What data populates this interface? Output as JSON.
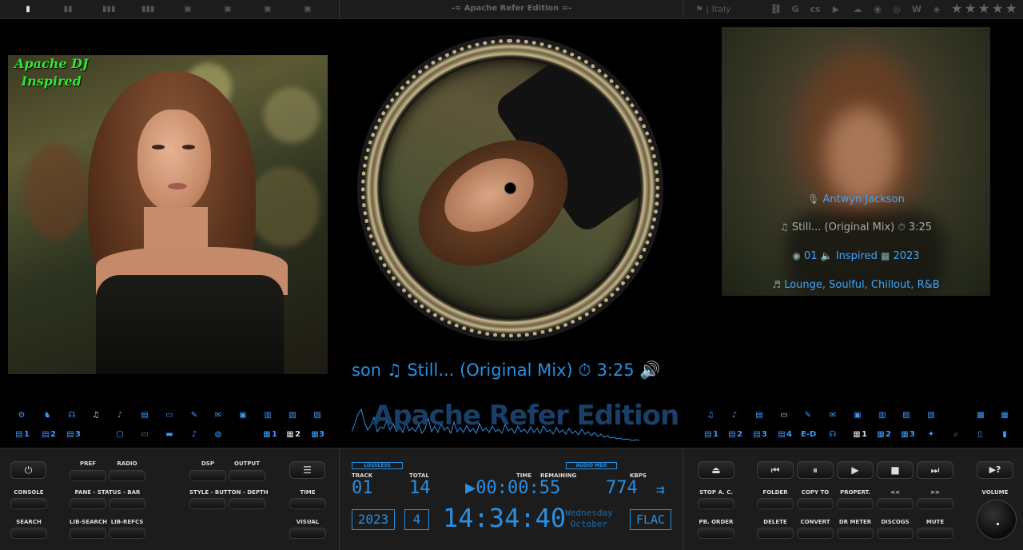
{
  "topbar": {
    "title": "-= Apache Refer Edition =-",
    "country": "Italy",
    "layout_icons": [
      "1",
      "2",
      "3",
      "4",
      "icon-a",
      "icon-b",
      "icon-c",
      "icon-d"
    ],
    "services": [
      "link-icon",
      "G",
      "cs",
      "youtube-icon",
      "soundcloud-icon",
      "spotify-icon",
      "discogs-icon",
      "W",
      "shazam-icon"
    ],
    "rating": 0
  },
  "left": {
    "badge_line1": "Apache DJ",
    "badge_line2": "Inspired"
  },
  "right_info": {
    "artist": "Antwyn Jackson",
    "title": "Still... (Original Mix)",
    "duration": "3:25",
    "track": "01",
    "album": "Inspired",
    "year": "2023",
    "genres": "Lounge, Soulful, Chillout, R&B"
  },
  "nowplaying": {
    "artist_tail": "son",
    "title": "Still... (Original Mix)",
    "duration": "3:25"
  },
  "wave_title": "Apache Refer Edition",
  "left_icons_row1": [
    "settings-icon",
    "dancer-icon",
    "headphones-icon",
    "music-icon",
    "guitar-icon",
    "document-icon",
    "screen-icon",
    "edit-icon",
    "mail-icon",
    "box-icon",
    "basket-icon",
    "image-icon",
    "gallery-icon"
  ],
  "left_icons_row2": {
    "a": "1",
    "b": "2",
    "c": "3",
    "d": "1",
    "e": "2",
    "f": "3"
  },
  "right_icons_row2": {
    "a": "1",
    "b": "2",
    "c": "3",
    "d": "4",
    "e": "E-D",
    "f": "1",
    "g": "2",
    "h": "3"
  },
  "bottom_left": {
    "pref": "PREF",
    "radio": "RADIO",
    "dsp": "DSP",
    "output": "OUTPUT",
    "console": "CONSOLE",
    "pane": "PANE - STATUS - BAR",
    "style": "STYLE - BUTTON - DEPTH",
    "time": "TIME",
    "search": "SEARCH",
    "lib_search": "LIB-SEARCH",
    "lib_refcs": "LIB-REFCS",
    "visual": "VISUAL"
  },
  "lcd": {
    "lossless": "LOSSLESS",
    "audio_mds": "AUDIO MDS",
    "track_lbl": "TRACK",
    "total_lbl": "TOTAL",
    "time_lbl": "TIME",
    "remaining_lbl": "REMAINING",
    "kbps_lbl": "KBPS",
    "track": "01",
    "total": "14",
    "time": "▶00:00:55",
    "kbps": "774",
    "year": "2023",
    "num": "4",
    "clock": "14:34:40",
    "weekday": "Wednesday",
    "month": "October",
    "format": "FLAC"
  },
  "bottom_right": {
    "stop_ac": "STOP A. C.",
    "folder": "FOLDER",
    "copy_to": "COPY TO",
    "propert": "PROPERT.",
    "prev": "<<",
    "next": ">>",
    "volume": "VOLUME",
    "pb_order": "PB. ORDER",
    "delete": "DELETE",
    "convert": "CONVERT",
    "dr_meter": "DR METER",
    "discogs": "DISCOGS",
    "mute": "MUTE",
    "help": "▶?"
  }
}
